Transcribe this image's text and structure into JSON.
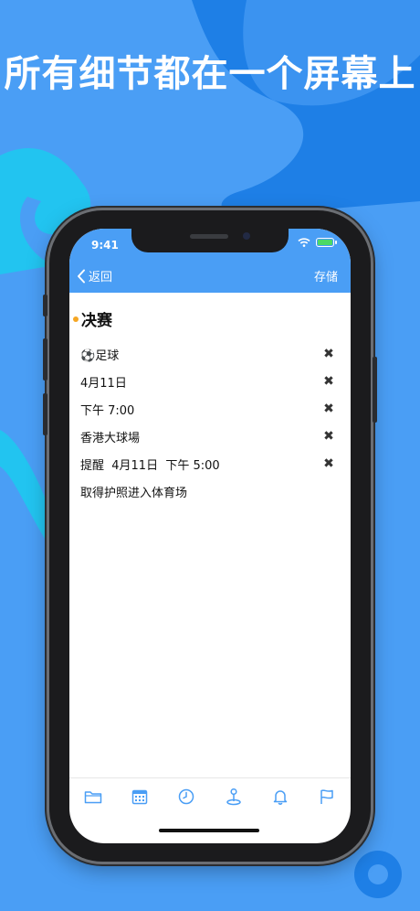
{
  "headline": "所有细节都在一个屏幕上",
  "colors": {
    "background": "#4a9ef5",
    "accent": "#4a9ef5",
    "wave_dark": "#1e7fe6",
    "wave_cyan": "#22c4f0",
    "dot": "#f5a623"
  },
  "status_bar": {
    "time": "9:41"
  },
  "nav": {
    "back_label": "返回",
    "save_label": "存储"
  },
  "event": {
    "title": "决赛",
    "fields": [
      {
        "icon": "⚽",
        "text": "足球",
        "clearable": true
      },
      {
        "text": "4月11日",
        "clearable": true
      },
      {
        "text": "下午 7:00",
        "clearable": true
      },
      {
        "text": "香港大球場",
        "clearable": true
      },
      {
        "text": "提醒  4月11日  下午 5:00",
        "clearable": true
      },
      {
        "text": "取得护照进入体育场",
        "clearable": false
      }
    ],
    "clear_symbol": "✖"
  },
  "tabbar": [
    "folder-icon",
    "calendar-icon",
    "clock-icon",
    "location-pin-icon",
    "bell-icon",
    "flag-icon"
  ]
}
